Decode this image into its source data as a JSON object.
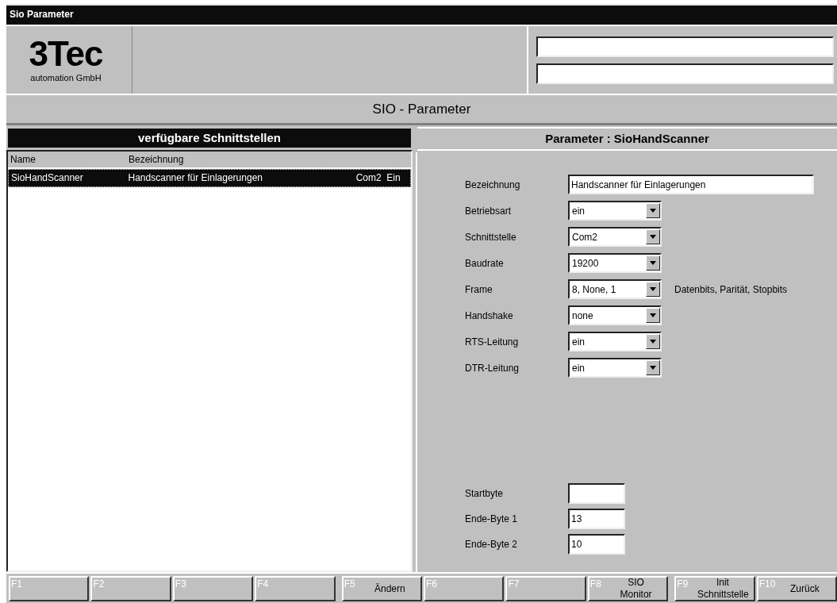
{
  "window": {
    "title": "Sio Parameter"
  },
  "logo": {
    "name": "3Tec",
    "subtitle": "automation GmbH"
  },
  "header_fields": [
    {
      "kind": "text"
    },
    {
      "kind": "text"
    }
  ],
  "page_title": "SIO - Parameter",
  "interfaces": {
    "title": "verfügbare Schnittstellen",
    "columns": [
      "Name",
      "Bezeichnung"
    ],
    "rows": [
      {
        "name": "SioHandScanner",
        "description": "Handscanner für Einlagerungen",
        "port": "Com2",
        "state": "Ein",
        "selected": true
      }
    ]
  },
  "parameters": {
    "title": "Parameter : SioHandScanner",
    "fields": [
      {
        "kind": "text",
        "label": "Bezeichnung",
        "value": "Handscanner für Einlagerungen"
      },
      {
        "kind": "select",
        "label": "Betriebsart",
        "value": "ein"
      },
      {
        "kind": "select",
        "label": "Schnittstelle",
        "value": "Com2"
      },
      {
        "kind": "select",
        "label": "Baudrate",
        "value": "19200"
      },
      {
        "kind": "select",
        "label": "Frame",
        "value": "8, None, 1",
        "note": "Datenbits, Parität, Stopbits"
      },
      {
        "kind": "select",
        "label": "Handshake",
        "value": "none"
      },
      {
        "kind": "select",
        "label": "RTS-Leitung",
        "value": "ein"
      },
      {
        "kind": "select",
        "label": "DTR-Leitung",
        "value": "ein"
      }
    ],
    "bytes": [
      {
        "label": "Startbyte"
      },
      {
        "label": "Ende-Byte 1",
        "value": "13"
      },
      {
        "label": "Ende-Byte 2",
        "value": "10"
      }
    ]
  },
  "function_keys": [
    {
      "key": "F1"
    },
    {
      "key": "F2"
    },
    {
      "key": "F3"
    },
    {
      "key": "F4"
    },
    {
      "key": "F5",
      "action": "Ändern"
    },
    {
      "key": "F6"
    },
    {
      "key": "F7"
    },
    {
      "key": "F8",
      "action": "SIO Monitor"
    },
    {
      "key": "F9",
      "action": "Init Schnittstelle"
    },
    {
      "key": "F10",
      "action": "Zurück"
    }
  ]
}
